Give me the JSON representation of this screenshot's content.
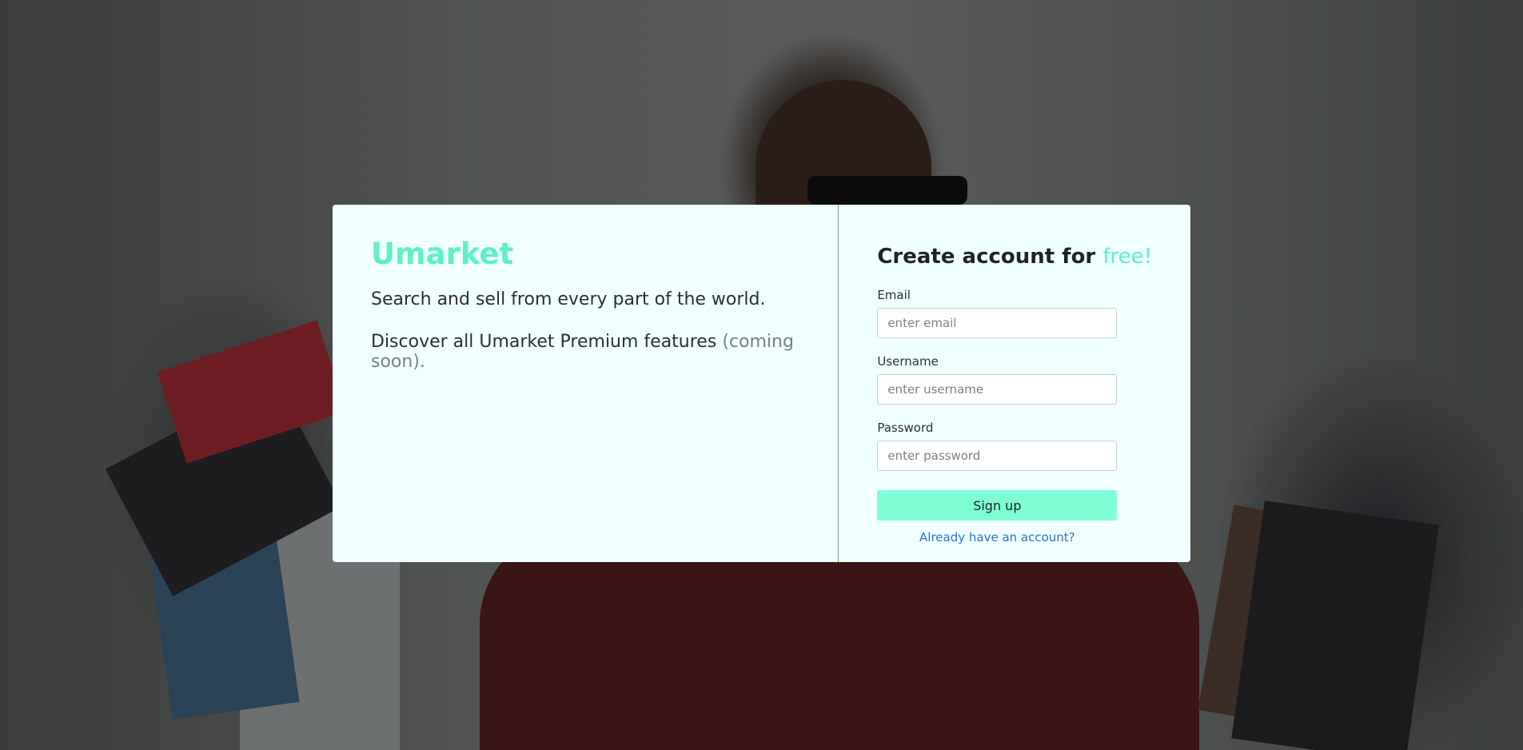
{
  "brand": {
    "name": "Umarket",
    "tagline": "Search and sell from every part of the world.",
    "premium_text": "Discover all Umarket Premium features ",
    "premium_note": "(coming soon)."
  },
  "signup": {
    "title_prefix": "Create account for ",
    "title_accent": "free!",
    "email_label": "Email",
    "email_placeholder": "enter email",
    "username_label": "Username",
    "username_placeholder": "enter username",
    "password_label": "Password",
    "password_placeholder": "enter password",
    "submit_label": "Sign up",
    "login_link": "Already have an account?"
  },
  "colors": {
    "accent": "#5ff0c8",
    "button": "#7fffd4",
    "card_background": "#f0ffff",
    "link": "#2d6fd6"
  }
}
